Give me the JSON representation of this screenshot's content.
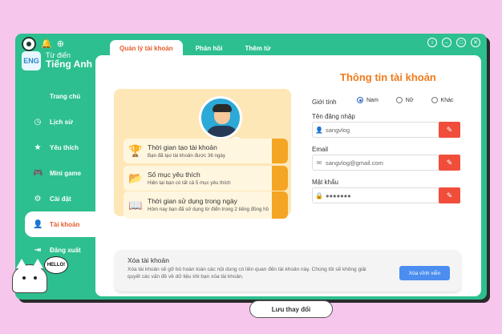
{
  "app": {
    "brand_line1": "Từ điển",
    "brand_line2": "Tiếng Anh",
    "logo_text": "ENG"
  },
  "sidebar": {
    "items": [
      {
        "label": "Trang chủ",
        "icon": "apple-icon"
      },
      {
        "label": "Lịch sử",
        "icon": "history-icon"
      },
      {
        "label": "Yêu thích",
        "icon": "star-icon"
      },
      {
        "label": "Mini game",
        "icon": "gamepad-icon"
      },
      {
        "label": "Cài đặt",
        "icon": "gear-icon"
      },
      {
        "label": "Tài khoản",
        "icon": "user-icon",
        "active": true
      },
      {
        "label": "Đăng xuất",
        "icon": "logout-icon"
      }
    ]
  },
  "cat": {
    "bubble_text": "HELLO!"
  },
  "tabs": [
    {
      "label": "Quản lý tài khoản",
      "active": true
    },
    {
      "label": "Phản hồi"
    },
    {
      "label": "Thêm từ"
    }
  ],
  "stats": [
    {
      "title": "Thời gian tạo tài khoản",
      "desc": "Bạn đã tạo tài khoản được 36 ngày",
      "icon": "trophy-icon"
    },
    {
      "title": "Số mục yêu thích",
      "desc": "Hiện tại bạn có tất cả  5 mục yêu thích",
      "icon": "folder-icon"
    },
    {
      "title": "Thời gian sử dụng trong ngày",
      "desc": "Hôm nay bạn đã sử dụng từ điển trong 2 tiếng đồng hồ",
      "icon": "glasses-book-icon"
    }
  ],
  "account": {
    "title": "Thông tin tài khoản",
    "gender_label": "Giới tính",
    "gender_options": [
      "Nam",
      "Nữ",
      "Khác"
    ],
    "gender_selected": "Nam",
    "username_label": "Tên đăng nhập",
    "username_value": "sangvlog",
    "email_label": "Email",
    "email_value": "sangvlog@gmail.com",
    "password_label": "Mật khẩu",
    "password_value": "●●●●●●●"
  },
  "delete": {
    "title": "Xóa tài khoản",
    "desc": "Xóa tài khoản sẽ gỡ bỏ hoàn toàn các nội dung có liên quan đến tài khoản này. Chúng tôi sẽ không giải quyết các vấn đề về dữ liệu khi bạn xóa tài khoản.",
    "button": "Xóa vĩnh viễn"
  },
  "save_button": "Lưu thay đổi",
  "colors": {
    "primary": "#2dbf8f",
    "accent": "#e85c2c",
    "edit": "#f04e3b",
    "delete_button": "#4b8ef0",
    "stats_bg": "#fde7b6",
    "background": "#f7c6ec"
  }
}
